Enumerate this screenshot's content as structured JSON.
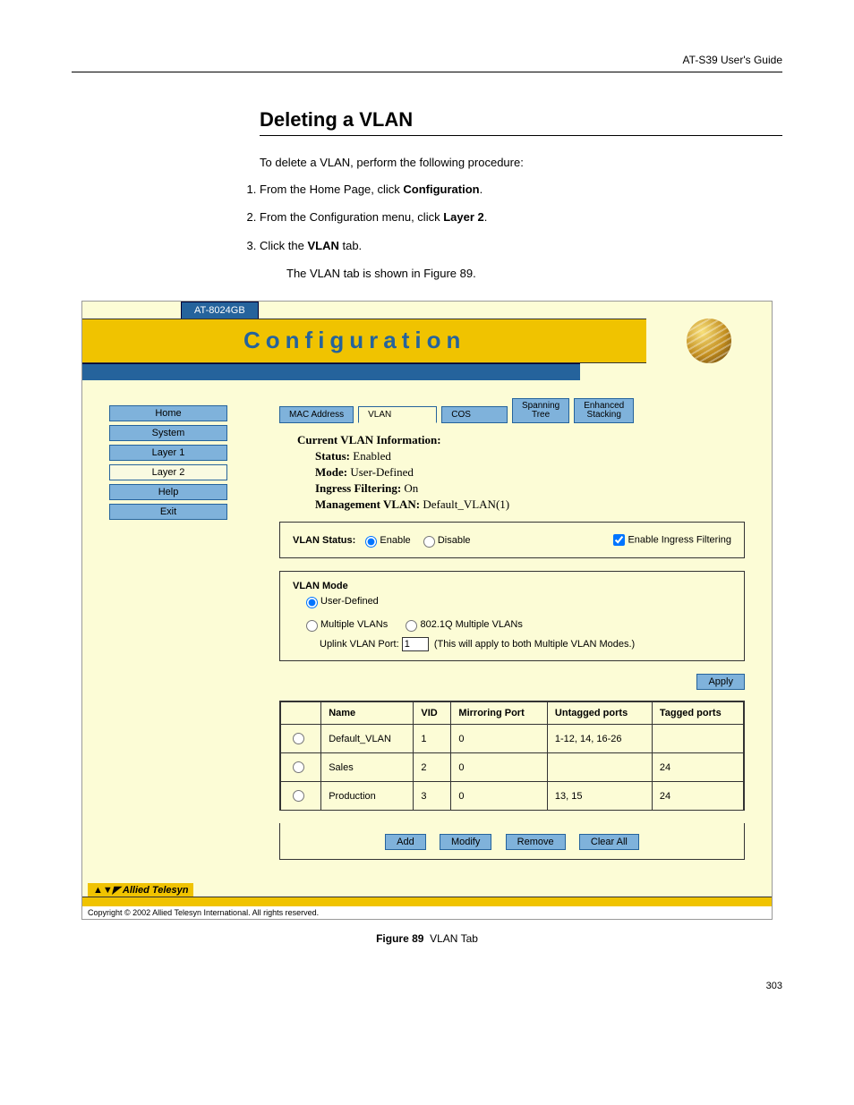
{
  "header": "AT-S39 User's Guide",
  "section_title": "Deleting a VLAN",
  "intro": "To delete a VLAN, perform the following procedure:",
  "steps": [
    "From the Home Page, click <b>Configuration</b>.",
    "From the Configuration menu, click <b>Layer 2</b>.",
    "Click the <b>VLAN</b> tab."
  ],
  "after_steps": "The VLAN tab is shown in Figure 89.",
  "screenshot": {
    "model": "AT-8024GB",
    "banner": "Configuration",
    "sidebar": [
      "Home",
      "System",
      "Layer 1",
      "Layer 2",
      "Help",
      "Exit"
    ],
    "sidebar_active": "Layer 2",
    "tabs": [
      {
        "label": "MAC Address"
      },
      {
        "label": "VLAN",
        "active": true
      },
      {
        "label": "COS"
      },
      {
        "label": "Spanning\nTree"
      },
      {
        "label": "Enhanced\nStacking"
      }
    ],
    "info_title": "Current VLAN Information:",
    "info": {
      "status_label": "Status:",
      "status": "Enabled",
      "mode_label": "Mode:",
      "mode": "User-Defined",
      "ingress_label": "Ingress Filtering:",
      "ingress": "On",
      "mgmt_label": "Management VLAN:",
      "mgmt": "Default_VLAN(1)"
    },
    "vlan_status": {
      "label": "VLAN Status:",
      "enable": "Enable",
      "disable": "Disable",
      "ingress_check": "Enable Ingress Filtering"
    },
    "vlan_mode": {
      "title": "VLAN Mode",
      "user_defined": "User-Defined",
      "multi": "Multiple VLANs",
      "dot1q": "802.1Q Multiple VLANs",
      "uplink_label": "Uplink VLAN Port:",
      "uplink_value": "1",
      "uplink_note": "(This will apply to both Multiple VLAN Modes.)"
    },
    "apply": "Apply",
    "table": {
      "headers": [
        "",
        "Name",
        "VID",
        "Mirroring Port",
        "Untagged ports",
        "Tagged ports"
      ],
      "rows": [
        {
          "name": "Default_VLAN",
          "vid": "1",
          "mirror": "0",
          "untagged": "1-12, 14, 16-26",
          "tagged": ""
        },
        {
          "name": "Sales",
          "vid": "2",
          "mirror": "0",
          "untagged": "",
          "tagged": "24"
        },
        {
          "name": "Production",
          "vid": "3",
          "mirror": "0",
          "untagged": "13, 15",
          "tagged": "24"
        }
      ]
    },
    "actions": [
      "Add",
      "Modify",
      "Remove",
      "Clear All"
    ],
    "brand": "Allied Telesyn",
    "copyright": "Copyright © 2002 Allied Telesyn International. All rights reserved."
  },
  "figure_caption": "Figure 89  VLAN Tab",
  "page_number": "303"
}
